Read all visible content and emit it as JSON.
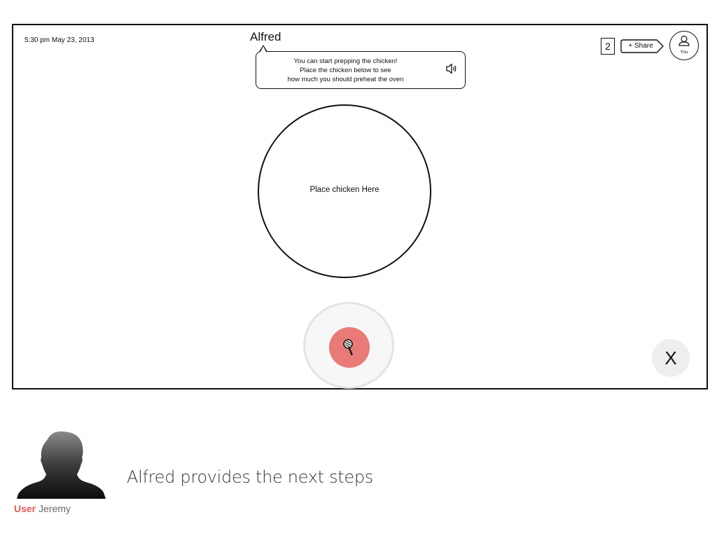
{
  "screen": {
    "datetime": "5:30 pm May 23, 2013",
    "assistant_name": "Alfred",
    "bubble": {
      "lines": [
        "You can start prepping the chicken!",
        "Place the chicken below to see",
        "how much you should preheat the oven"
      ],
      "speaker_icon": "speaker-icon"
    },
    "count_badge": "2",
    "share_label": "+ Share",
    "avatar_label": "You",
    "drop_zone_label": "Place chicken Here",
    "mic_icon": "microphone-icon",
    "close_label": "X"
  },
  "persona": {
    "role": "User",
    "name": "Jeremy",
    "silhouette_icon": "user-silhouette-icon"
  },
  "scenario_text": "Alfred provides the next steps",
  "colors": {
    "mic_button": "#e97a77",
    "role_label": "#e55b54",
    "close_button": "#eeeeee"
  }
}
